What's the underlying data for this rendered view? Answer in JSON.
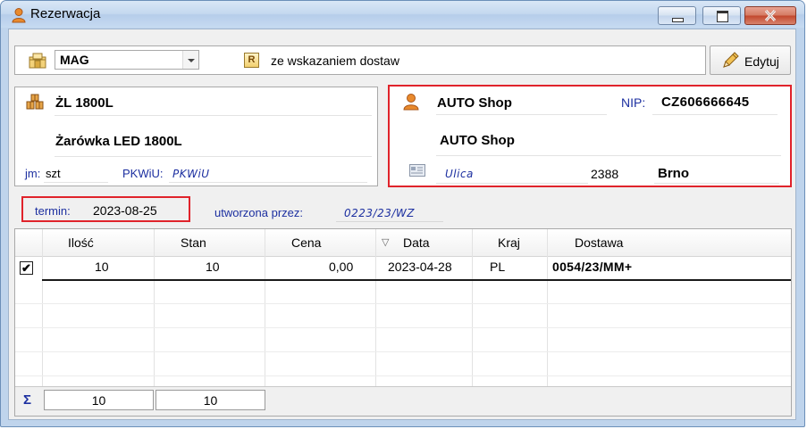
{
  "window": {
    "title": "Rezerwacja"
  },
  "toolbar": {
    "warehouse": "MAG",
    "delivery_mode_icon": "R",
    "delivery_mode_label": "ze wskazaniem dostaw",
    "edit_label": "Edytuj"
  },
  "product": {
    "code": "ŻL 1800L",
    "name": "Żarówka LED 1800L",
    "unit_label": "jm:",
    "unit": "szt",
    "pkwiu_label": "PKWiU:",
    "pkwiu": "PKWiU"
  },
  "customer": {
    "short_name": "AUTO Shop",
    "nip_label": "NIP:",
    "nip": "CZ606666645",
    "full_name": "AUTO Shop",
    "street": "Ulica",
    "postal_code": "2388",
    "city": "Brno"
  },
  "reservation": {
    "termin_label": "termin:",
    "termin": "2023-08-25",
    "created_by_label": "utworzona przez:",
    "created_by": "0223/23/WZ"
  },
  "grid": {
    "columns": [
      "Ilość",
      "Stan",
      "Cena",
      "Data",
      "Kraj",
      "Dostawa"
    ],
    "sort_indicator": "▽",
    "rows": [
      {
        "checked": "✔",
        "ilosc": "10",
        "stan": "10",
        "cena": "0,00",
        "data": "2023-04-28",
        "kraj": "PL",
        "dostawa": "0054/23/MM+"
      }
    ],
    "footer": {
      "sigma": "Σ",
      "sum_ilosc": "10",
      "sum_stan": "10"
    }
  }
}
